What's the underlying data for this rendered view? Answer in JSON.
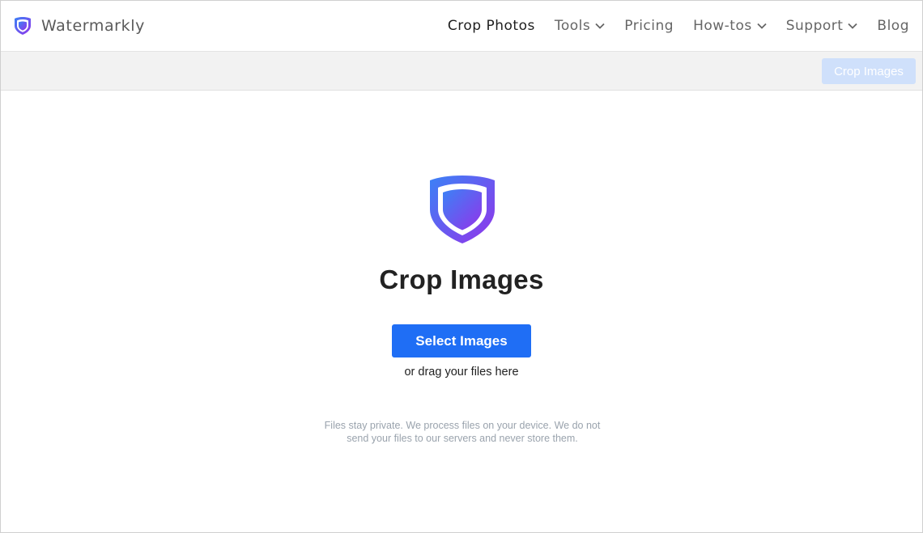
{
  "header": {
    "brand_name": "Watermarkly",
    "brand_colors": {
      "gradient_start": "#3b82f6",
      "gradient_end": "#9333ea",
      "inner": "#ffffff"
    },
    "nav": [
      {
        "label": "Crop Photos",
        "active": true,
        "dropdown": false
      },
      {
        "label": "Tools",
        "active": false,
        "dropdown": true
      },
      {
        "label": "Pricing",
        "active": false,
        "dropdown": false
      },
      {
        "label": "How-tos",
        "active": false,
        "dropdown": true
      },
      {
        "label": "Support",
        "active": false,
        "dropdown": true
      },
      {
        "label": "Blog",
        "active": false,
        "dropdown": false
      }
    ]
  },
  "toolbar": {
    "action_label": "Crop Images",
    "action_disabled": true
  },
  "main": {
    "logo_icon": "shield-logo-icon",
    "title": "Crop Images",
    "select_button_label": "Select Images",
    "drag_hint": "or drag your files here",
    "privacy_line1": "Files stay private. We process files on your device. We do not",
    "privacy_line2": "send your files to our servers and never store them."
  },
  "colors": {
    "primary_button": "#1f6ef5",
    "disabled_button": "#cfe0fb",
    "strip_background": "#f2f2f2",
    "muted_text": "#9aa3ad"
  }
}
